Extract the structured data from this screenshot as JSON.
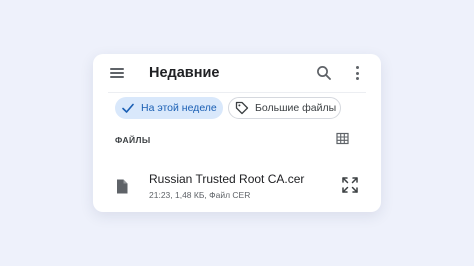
{
  "header": {
    "title": "Недавние",
    "menu_icon": "hamburger-menu-icon",
    "search_icon": "search-icon",
    "more_icon": "more-vertical-icon"
  },
  "filters": {
    "chips": [
      {
        "label": "На этой неделе",
        "selected": true,
        "icon": "check-icon"
      },
      {
        "label": "Большие файлы",
        "selected": false,
        "icon": "tag-icon"
      }
    ]
  },
  "files_section": {
    "label": "ФАЙЛЫ",
    "view_icon": "grid-view-icon"
  },
  "files": [
    {
      "name": "Russian Trusted Root CA.cer",
      "meta": "21:23, 1,48 КБ, Файл CER",
      "icon": "file-icon",
      "action_icon": "expand-icon"
    }
  ],
  "colors": {
    "page_background": "#eef1fb",
    "card_background": "#ffffff",
    "chip_selected_bg": "#d9e8fb",
    "chip_selected_text": "#1a5fb4"
  }
}
